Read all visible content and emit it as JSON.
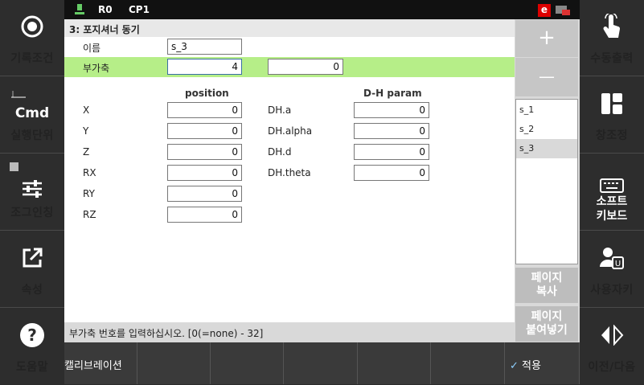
{
  "status_bar": {
    "robot": "R0",
    "program": "CP1",
    "badge": "e"
  },
  "left_panel": [
    {
      "label": "기록조건",
      "icon": "record-circle-icon"
    },
    {
      "label": "실행단위",
      "icon": "cmd-icon",
      "icon_text": "Cmd"
    },
    {
      "label": "조그인칭",
      "icon": "sliders-icon"
    },
    {
      "label": "속성",
      "icon": "edit-external-icon"
    },
    {
      "label": "도움말",
      "icon": "help-icon"
    }
  ],
  "right_panel": [
    {
      "label": "수동출력",
      "icon": "hand-pointer-icon"
    },
    {
      "label": "창조정",
      "icon": "window-layout-icon"
    },
    {
      "label": "소프트\n키보드",
      "icon": "keyboard-icon"
    },
    {
      "label": "사용자키",
      "icon": "user-key-icon"
    },
    {
      "label": "이전/다음",
      "icon": "prev-next-icon"
    }
  ],
  "form": {
    "title": "3: 포지셔너 동기",
    "name_label": "이름",
    "name_value": "s_3",
    "aux_label": "부가축",
    "aux_value1": "4",
    "aux_value2": "0",
    "position_header": "position",
    "dh_header": "D-H param",
    "position_rows": [
      {
        "label": "X",
        "value": "0"
      },
      {
        "label": "Y",
        "value": "0"
      },
      {
        "label": "Z",
        "value": "0"
      },
      {
        "label": "RX",
        "value": "0"
      },
      {
        "label": "RY",
        "value": "0"
      },
      {
        "label": "RZ",
        "value": "0"
      }
    ],
    "dh_rows": [
      {
        "label": "DH.a",
        "value": "0"
      },
      {
        "label": "DH.alpha",
        "value": "0"
      },
      {
        "label": "DH.d",
        "value": "0"
      },
      {
        "label": "DH.theta",
        "value": "0"
      }
    ]
  },
  "list": {
    "add_symbol": "+",
    "remove_symbol": "—",
    "items": [
      "s_1",
      "s_2",
      "s_3"
    ],
    "selected": "s_3",
    "copy_page": "페이지\n복사",
    "paste_page": "페이지\n붙여넣기"
  },
  "status_message": "부가축 번호를 입력하십시오. [0(=none) - 32]",
  "bottom": {
    "calibration": "캘리브레이션",
    "apply": "적용"
  },
  "colors": {
    "highlight_row": "#b6ee88",
    "selected_item": "#d9d9d9"
  }
}
